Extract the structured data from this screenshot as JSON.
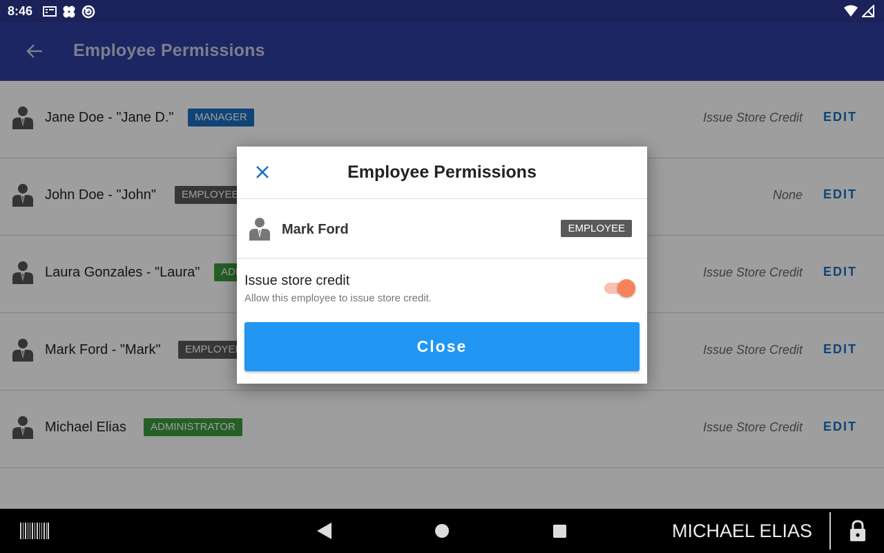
{
  "status_bar": {
    "time": "8:46"
  },
  "app_bar": {
    "title": "Employee Permissions"
  },
  "employees": [
    {
      "name": "Jane Doe - \"Jane D.\"",
      "role": "MANAGER",
      "role_color": "#1b6fc2",
      "permission": "Issue Store Credit",
      "edit_label": "EDIT"
    },
    {
      "name": "John Doe - \"John\"",
      "role": "EMPLOYEE",
      "role_color": "#5a5a5a",
      "permission": "None",
      "edit_label": "EDIT"
    },
    {
      "name": "Laura Gonzales - \"Laura\"",
      "role": "ADMINISTRATOR",
      "role_color": "#3d9a3d",
      "permission": "Issue Store Credit",
      "edit_label": "EDIT"
    },
    {
      "name": "Mark Ford - \"Mark\"",
      "role": "EMPLOYEE",
      "role_color": "#5a5a5a",
      "permission": "Issue Store Credit",
      "edit_label": "EDIT"
    },
    {
      "name": "Michael Elias",
      "role": "ADMINISTRATOR",
      "role_color": "#3d9a3d",
      "permission": "Issue Store Credit",
      "edit_label": "EDIT"
    }
  ],
  "dialog": {
    "title": "Employee Permissions",
    "employee_name": "Mark Ford",
    "employee_role": "EMPLOYEE",
    "permission_title": "Issue store credit",
    "permission_description": "Allow this employee to issue store credit.",
    "permission_enabled": true,
    "close_label": "Close"
  },
  "nav_bar": {
    "user_name": "MICHAEL ELIAS"
  },
  "colors": {
    "app_bar": "#2d3e9f",
    "status_bar": "#1b2259",
    "accent": "#2196f3",
    "toggle_on": "#f7825a"
  }
}
